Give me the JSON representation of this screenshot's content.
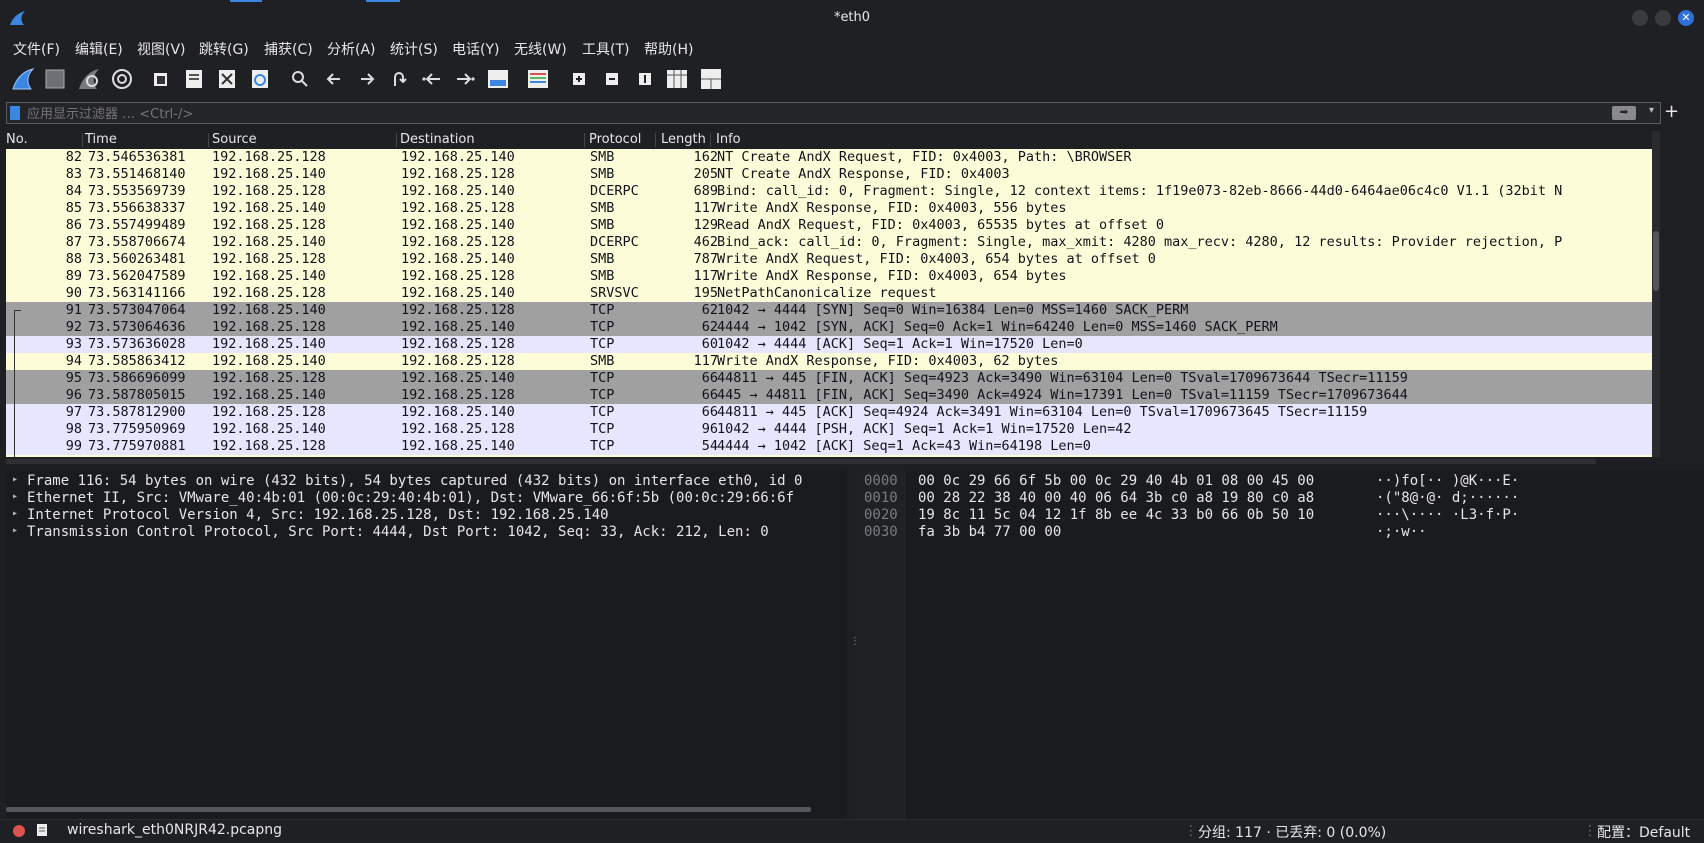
{
  "window": {
    "title": "*eth0"
  },
  "menu": [
    "文件(F)",
    "编辑(E)",
    "视图(V)",
    "跳转(G)",
    "捕获(C)",
    "分析(A)",
    "统计(S)",
    "电话(Y)",
    "无线(W)",
    "工具(T)",
    "帮助(H)"
  ],
  "toolbar": {
    "icons": [
      "start-capture-icon",
      "stop-capture-icon",
      "restart-capture-icon",
      "capture-options-icon",
      "open-file-icon",
      "save-file-icon",
      "close-file-icon",
      "reload-file-icon",
      "find-packet-icon",
      "go-back-icon",
      "go-forward-icon",
      "go-to-packet-icon",
      "first-packet-icon",
      "last-packet-icon",
      "autoscroll-icon",
      "colorize-icon",
      "zoom-in-icon",
      "zoom-out-icon",
      "normal-size-icon",
      "resize-columns-icon",
      "layout-icon"
    ]
  },
  "filter": {
    "placeholder": "应用显示过滤器 … <Ctrl-/>",
    "add_label": "+"
  },
  "columns": [
    "No.",
    "Time",
    "Source",
    "Destination",
    "Protocol",
    "Length",
    "Info"
  ],
  "packets": [
    {
      "no": "82",
      "time": "73.546536381",
      "src": "192.168.25.128",
      "dst": "192.168.25.140",
      "proto": "SMB",
      "len": "162",
      "info": "NT Create AndX Request, FID: 0x4003, Path: \\BROWSER",
      "bg": "#fdfcd8"
    },
    {
      "no": "83",
      "time": "73.551468140",
      "src": "192.168.25.140",
      "dst": "192.168.25.128",
      "proto": "SMB",
      "len": "205",
      "info": "NT Create AndX Response, FID: 0x4003",
      "bg": "#fdfcd8"
    },
    {
      "no": "84",
      "time": "73.553569739",
      "src": "192.168.25.128",
      "dst": "192.168.25.140",
      "proto": "DCERPC",
      "len": "689",
      "info": "Bind: call_id: 0, Fragment: Single, 12 context items: 1f19e073-82eb-8666-44d0-6464ae06c4c0 V1.1 (32bit N",
      "bg": "#fdfcd8"
    },
    {
      "no": "85",
      "time": "73.556638337",
      "src": "192.168.25.140",
      "dst": "192.168.25.128",
      "proto": "SMB",
      "len": "117",
      "info": "Write AndX Response, FID: 0x4003, 556 bytes",
      "bg": "#fdfcd8"
    },
    {
      "no": "86",
      "time": "73.557499489",
      "src": "192.168.25.128",
      "dst": "192.168.25.140",
      "proto": "SMB",
      "len": "129",
      "info": "Read AndX Request, FID: 0x4003, 65535 bytes at offset 0",
      "bg": "#fdfcd8"
    },
    {
      "no": "87",
      "time": "73.558706674",
      "src": "192.168.25.140",
      "dst": "192.168.25.128",
      "proto": "DCERPC",
      "len": "462",
      "info": "Bind_ack: call_id: 0, Fragment: Single, max_xmit: 4280 max_recv: 4280, 12 results: Provider rejection, P",
      "bg": "#fdfcd8"
    },
    {
      "no": "88",
      "time": "73.560263481",
      "src": "192.168.25.128",
      "dst": "192.168.25.140",
      "proto": "SMB",
      "len": "787",
      "info": "Write AndX Request, FID: 0x4003, 654 bytes at offset 0",
      "bg": "#fdfcd8"
    },
    {
      "no": "89",
      "time": "73.562047589",
      "src": "192.168.25.140",
      "dst": "192.168.25.128",
      "proto": "SMB",
      "len": "117",
      "info": "Write AndX Response, FID: 0x4003, 654 bytes",
      "bg": "#fdfcd8"
    },
    {
      "no": "90",
      "time": "73.563141166",
      "src": "192.168.25.128",
      "dst": "192.168.25.140",
      "proto": "SRVSVC",
      "len": "195",
      "info": "NetPathCanonicalize request",
      "bg": "#fdfcd8"
    },
    {
      "no": "91",
      "time": "73.573047064",
      "src": "192.168.25.140",
      "dst": "192.168.25.128",
      "proto": "TCP",
      "len": "62",
      "info": "1042 → 4444 [SYN] Seq=0 Win=16384 Len=0 MSS=1460 SACK_PERM",
      "bg": "#a0a0a0"
    },
    {
      "no": "92",
      "time": "73.573064636",
      "src": "192.168.25.128",
      "dst": "192.168.25.140",
      "proto": "TCP",
      "len": "62",
      "info": "4444 → 1042 [SYN, ACK] Seq=0 Ack=1 Win=64240 Len=0 MSS=1460 SACK_PERM",
      "bg": "#a0a0a0"
    },
    {
      "no": "93",
      "time": "73.573636028",
      "src": "192.168.25.140",
      "dst": "192.168.25.128",
      "proto": "TCP",
      "len": "60",
      "info": "1042 → 4444 [ACK] Seq=1 Ack=1 Win=17520 Len=0",
      "bg": "#e7e6ff"
    },
    {
      "no": "94",
      "time": "73.585863412",
      "src": "192.168.25.140",
      "dst": "192.168.25.128",
      "proto": "SMB",
      "len": "117",
      "info": "Write AndX Response, FID: 0x4003, 62 bytes",
      "bg": "#fdfcd8"
    },
    {
      "no": "95",
      "time": "73.586696099",
      "src": "192.168.25.128",
      "dst": "192.168.25.140",
      "proto": "TCP",
      "len": "66",
      "info": "44811 → 445 [FIN, ACK] Seq=4923 Ack=3490 Win=63104 Len=0 TSval=1709673644 TSecr=11159",
      "bg": "#a0a0a0"
    },
    {
      "no": "96",
      "time": "73.587805015",
      "src": "192.168.25.140",
      "dst": "192.168.25.128",
      "proto": "TCP",
      "len": "66",
      "info": "445 → 44811 [FIN, ACK] Seq=3490 Ack=4924 Win=17391 Len=0 TSval=11159 TSecr=1709673644",
      "bg": "#a0a0a0"
    },
    {
      "no": "97",
      "time": "73.587812900",
      "src": "192.168.25.128",
      "dst": "192.168.25.140",
      "proto": "TCP",
      "len": "66",
      "info": "44811 → 445 [ACK] Seq=4924 Ack=3491 Win=63104 Len=0 TSval=1709673645 TSecr=11159",
      "bg": "#e7e6ff"
    },
    {
      "no": "98",
      "time": "73.775950969",
      "src": "192.168.25.140",
      "dst": "192.168.25.128",
      "proto": "TCP",
      "len": "96",
      "info": "1042 → 4444 [PSH, ACK] Seq=1 Ack=1 Win=17520 Len=42",
      "bg": "#e7e6ff"
    },
    {
      "no": "99",
      "time": "73.775970881",
      "src": "192.168.25.128",
      "dst": "192.168.25.140",
      "proto": "TCP",
      "len": "54",
      "info": "4444 → 1042 [ACK] Seq=1 Ack=43 Win=64198 Len=0",
      "bg": "#e7e6ff"
    }
  ],
  "details": [
    "Frame 116: 54 bytes on wire (432 bits), 54 bytes captured (432 bits) on interface eth0, id 0",
    "Ethernet II, Src: VMware_40:4b:01 (00:0c:29:40:4b:01), Dst: VMware_66:6f:5b (00:0c:29:66:6f",
    "Internet Protocol Version 4, Src: 192.168.25.128, Dst: 192.168.25.140",
    "Transmission Control Protocol, Src Port: 4444, Dst Port: 1042, Seq: 33, Ack: 212, Len: 0"
  ],
  "hex": [
    {
      "off": "0000",
      "bytes": "00 0c 29 66 6f 5b 00 0c  29 40 4b 01 08 00 45 00",
      "ascii": "··)fo[··  )@K···E·"
    },
    {
      "off": "0010",
      "bytes": "00 28 22 38 40 00 40 06  64 3b c0 a8 19 80 c0 a8",
      "ascii": "·(\"8@·@·  d;······"
    },
    {
      "off": "0020",
      "bytes": "19 8c 11 5c 04 12 1f 8b  ee 4c 33 b0 66 0b 50 10",
      "ascii": "···\\····  ·L3·f·P·"
    },
    {
      "off": "0030",
      "bytes": "fa 3b b4 77 00 00",
      "ascii": "·;·w··"
    }
  ],
  "status": {
    "file": "wireshark_eth0NRJR42.pcapng",
    "packets": "分组: 117 · 已丢弃: 0 (0.0%)",
    "profile": "配置：Default"
  },
  "colors": {
    "smb_bg": "#fdfcd8",
    "tcp_ctrl_bg": "#a0a0a0",
    "tcp_bg": "#e7e6ff",
    "accent": "#3a86e0"
  }
}
